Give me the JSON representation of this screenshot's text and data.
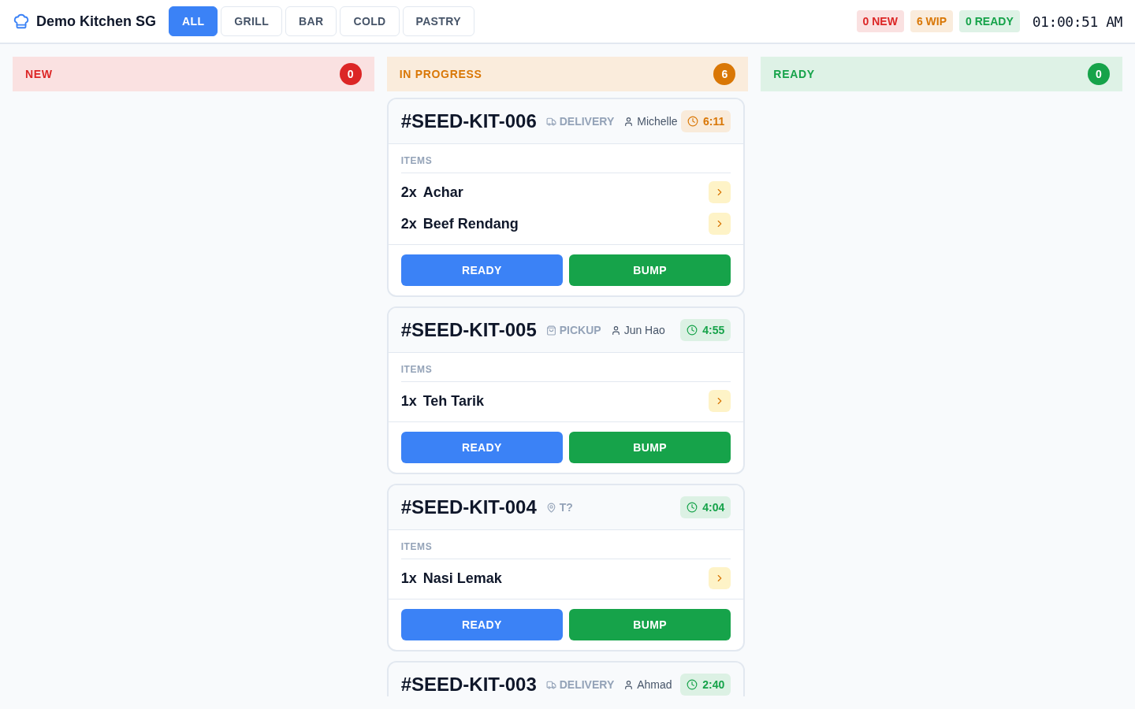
{
  "brand": {
    "name": "Demo Kitchen SG"
  },
  "stations": [
    {
      "label": "ALL",
      "selected": true
    },
    {
      "label": "GRILL",
      "selected": false
    },
    {
      "label": "BAR",
      "selected": false
    },
    {
      "label": "COLD",
      "selected": false
    },
    {
      "label": "PASTRY",
      "selected": false
    }
  ],
  "summary": [
    {
      "label": "0 NEW",
      "color": "#dc2626"
    },
    {
      "label": "6 WIP",
      "color": "#d97706"
    },
    {
      "label": "0 READY",
      "color": "#16a34a"
    }
  ],
  "clock": "01:00:51 AM",
  "columns": [
    {
      "title": "NEW",
      "count": "0",
      "color": "#dc2626"
    },
    {
      "title": "IN PROGRESS",
      "count": "6",
      "color": "#d97706",
      "orders": [
        {
          "id": "#SEED-KIT-006",
          "type": {
            "kind": "delivery",
            "label": "DELIVERY"
          },
          "customer": "Michelle",
          "timer": {
            "text": "6:11",
            "color": "#d97706"
          },
          "items_label": "ITEMS",
          "items": [
            {
              "qty": "2x",
              "name": "Achar"
            },
            {
              "qty": "2x",
              "name": "Beef Rendang"
            }
          ],
          "actions": [
            "READY",
            "BUMP"
          ]
        },
        {
          "id": "#SEED-KIT-005",
          "type": {
            "kind": "pickup",
            "label": "PICKUP"
          },
          "customer": "Jun Hao",
          "timer": {
            "text": "4:55",
            "color": "#16a34a"
          },
          "items_label": "ITEMS",
          "items": [
            {
              "qty": "1x",
              "name": "Teh Tarik"
            }
          ],
          "actions": [
            "READY",
            "BUMP"
          ]
        },
        {
          "id": "#SEED-KIT-004",
          "type": {
            "kind": "table",
            "label": "T?"
          },
          "timer": {
            "text": "4:04",
            "color": "#16a34a"
          },
          "items_label": "ITEMS",
          "items": [
            {
              "qty": "1x",
              "name": "Nasi Lemak"
            }
          ],
          "actions": [
            "READY",
            "BUMP"
          ]
        },
        {
          "id": "#SEED-KIT-003",
          "type": {
            "kind": "delivery",
            "label": "DELIVERY"
          },
          "customer": "Ahmad",
          "timer": {
            "text": "2:40",
            "color": "#16a34a"
          }
        }
      ]
    },
    {
      "title": "READY",
      "count": "0",
      "color": "#16a34a"
    }
  ]
}
